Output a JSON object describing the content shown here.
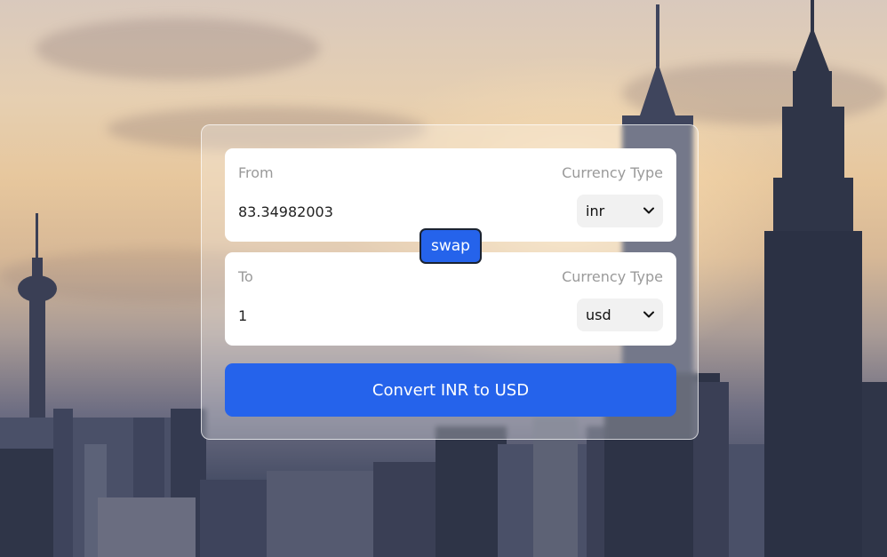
{
  "converter": {
    "from": {
      "label": "From",
      "currency_type_label": "Currency Type",
      "amount": "83.34982003",
      "currency": "inr"
    },
    "to": {
      "label": "To",
      "currency_type_label": "Currency Type",
      "amount": "1",
      "currency": "usd"
    },
    "swap_label": "swap",
    "convert_label": "Convert INR to USD"
  },
  "colors": {
    "accent": "#2563eb",
    "field_bg": "#ffffff",
    "select_bg": "#f1f1f1",
    "label_text": "#9a9a9a"
  },
  "icons": {
    "select_chevron": "chevron-down-icon"
  }
}
